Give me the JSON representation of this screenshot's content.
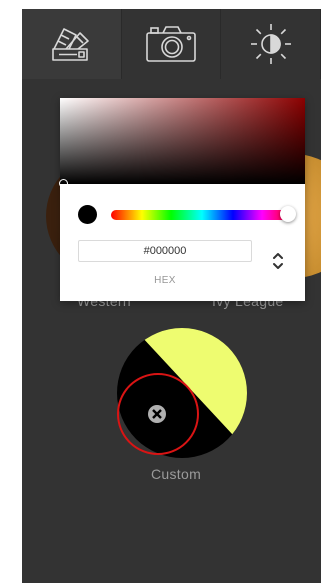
{
  "tabs": [
    {
      "name": "palette",
      "icon": "color-swatch-icon",
      "active": true
    },
    {
      "name": "camera",
      "icon": "camera-icon",
      "active": false
    },
    {
      "name": "brightness",
      "icon": "brightness-icon",
      "active": false
    }
  ],
  "swatches": {
    "western_label": "Western",
    "ivy_league_label": "Ivy League",
    "custom": {
      "label": "Custom",
      "color_primary": "#000000",
      "color_secondary": "#eefc70"
    }
  },
  "color_picker": {
    "hex_value": "#000000",
    "mode_label": "HEX",
    "current_color": "#000000",
    "base_hue_color": "#8b0000"
  },
  "colors": {
    "panel_bg": "#333333",
    "label_gray": "#9a9a9a",
    "highlight_ring": "#d91414"
  }
}
